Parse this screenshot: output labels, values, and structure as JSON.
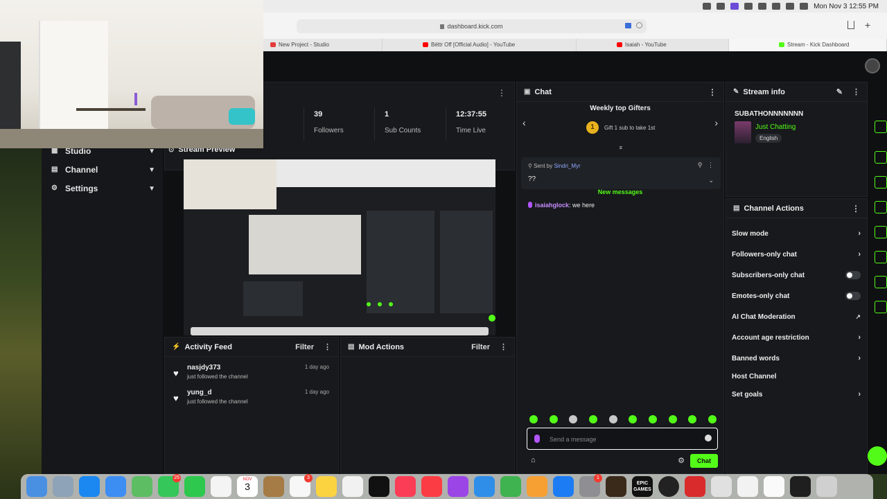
{
  "menubar": {
    "clock": "Mon Nov 3  12:55 PM"
  },
  "browser": {
    "url": "dashboard.kick.com",
    "tabs": [
      {
        "label": "New Project - Studio",
        "favicon_color": "#e43b3b"
      },
      {
        "label": "Bëttr Off [Official Audio] - YouTube",
        "favicon_color": "#ff0000"
      },
      {
        "label": "Isaiah - YouTube",
        "favicon_color": "#ff0000"
      },
      {
        "label": "Stream - Kick Dashboard",
        "favicon_color": "#53fc18"
      }
    ]
  },
  "sidebar": {
    "items": [
      {
        "label": "Studio",
        "icon": "grid-icon"
      },
      {
        "label": "Channel",
        "icon": "channel-icon"
      },
      {
        "label": "Settings",
        "icon": "gear-icon"
      }
    ]
  },
  "stats": {
    "items": [
      {
        "value": "39",
        "label": "Followers"
      },
      {
        "value": "1",
        "label": "Sub Counts"
      },
      {
        "value": "12:37:55",
        "label": "Time Live"
      }
    ],
    "partial_label": "s"
  },
  "stream_preview": {
    "title": "Stream Preview"
  },
  "activity_feed": {
    "title": "Activity Feed",
    "filter_label": "Filter",
    "items": [
      {
        "user": "nasjdy373",
        "action": "just followed the channel",
        "time": "1 day ago"
      },
      {
        "user": "yung_d",
        "action": "just followed the channel",
        "time": "1 day ago"
      }
    ]
  },
  "mod_actions": {
    "title": "Mod Actions",
    "filter_label": "Filter"
  },
  "chat": {
    "title": "Chat",
    "gifters_title": "Weekly top Gifters",
    "gifters_rank": "1",
    "gifters_text": "Gift 1 sub to take 1st",
    "pinned": {
      "sent_by_label": "Sent by",
      "sent_by_user": "Sindri_Myr",
      "message": "??"
    },
    "new_messages": "New messages",
    "messages": [
      {
        "user": "isaiahglock",
        "text": "we here"
      }
    ],
    "input_placeholder": "Send a message",
    "send_label": "Chat"
  },
  "stream_info": {
    "title": "Stream info",
    "stream_title": "SUBATHONNNNNNN",
    "category": "Just Chatting",
    "language": "English"
  },
  "channel_actions": {
    "title": "Channel Actions",
    "items": [
      {
        "label": "Slow mode",
        "control": "chevron"
      },
      {
        "label": "Followers-only chat",
        "control": "chevron"
      },
      {
        "label": "Subscribers-only chat",
        "control": "toggle"
      },
      {
        "label": "Emotes-only chat",
        "control": "toggle"
      },
      {
        "label": "AI Chat Moderation",
        "control": "external"
      },
      {
        "label": "Account age restriction",
        "control": "chevron"
      },
      {
        "label": "Banned words",
        "control": "chevron"
      },
      {
        "label": "Host Channel",
        "control": "none"
      },
      {
        "label": "Set goals",
        "control": "chevron"
      }
    ]
  },
  "dock": {
    "calendar_month": "NOV",
    "calendar_day": "3",
    "messages_badge": "25",
    "reminders_badge": "3",
    "screen_record_badge": "1",
    "epic_label": "EPIC GAMES"
  },
  "colors": {
    "kick_green": "#53fc18",
    "panel_bg": "#17191c",
    "app_bg": "#0f1012"
  }
}
